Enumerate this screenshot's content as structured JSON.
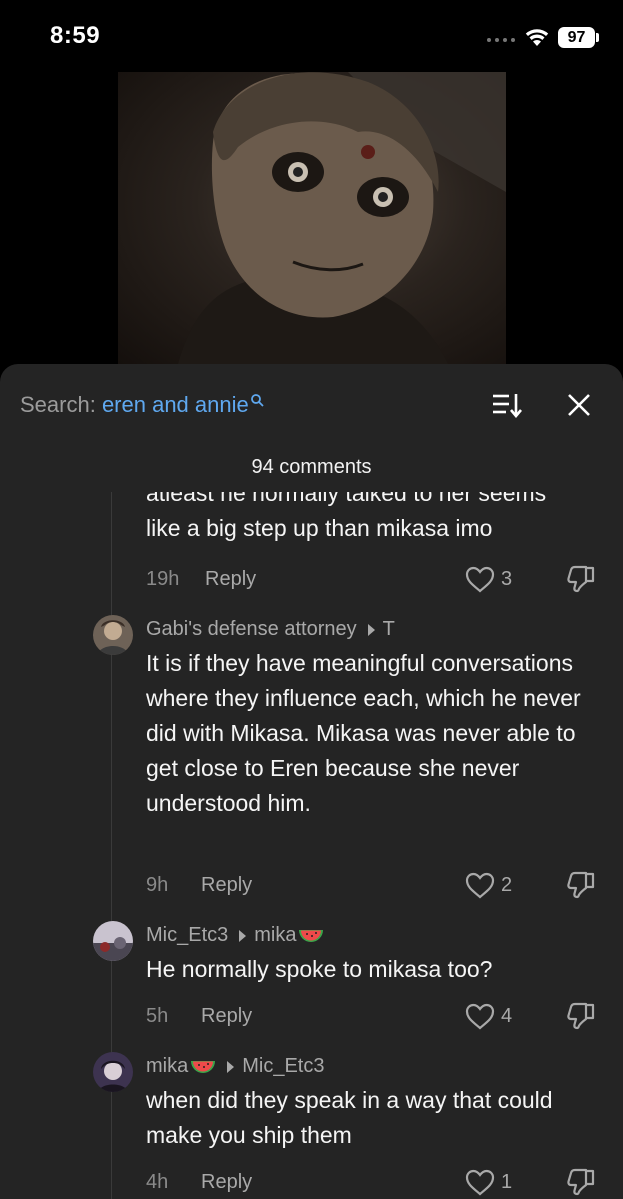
{
  "status_bar": {
    "time": "8:59",
    "battery": "97"
  },
  "search": {
    "label": "Search: ",
    "query": "eren and annie"
  },
  "comments_count": "94 comments",
  "comments": [
    {
      "text": "atleast he normally talked to her seems like a big step up than mikasa imo",
      "age": "19h",
      "reply_label": "Reply",
      "likes": "3"
    },
    {
      "user": "Gabi's defense attorney",
      "reply_to": "T",
      "text": "It is if they have meaningful conversations where they influence each, which he never did with Mikasa. Mikasa was never able to get close to Eren because she never understood him.",
      "age": "9h",
      "reply_label": "Reply",
      "likes": "2"
    },
    {
      "user": "Mic_Etc3",
      "reply_to": "mika",
      "text": "He normally spoke to mikasa too?",
      "age": "5h",
      "reply_label": "Reply",
      "likes": "4"
    },
    {
      "user": "mika",
      "reply_to": "Mic_Etc3",
      "text": "when did they speak in a way that could make you ship them",
      "age": "4h",
      "reply_label": "Reply",
      "likes": "1"
    }
  ],
  "icons": {
    "wifi": "wifi-icon",
    "search": "search-icon",
    "sort": "sort-icon",
    "close": "close-icon",
    "like": "heart-icon",
    "dislike": "thumbs-down-icon",
    "emoji": "watermelon-icon"
  },
  "colors": {
    "accent": "#5fa8ef",
    "panel": "#242424",
    "muted": "#a9a9a9"
  }
}
